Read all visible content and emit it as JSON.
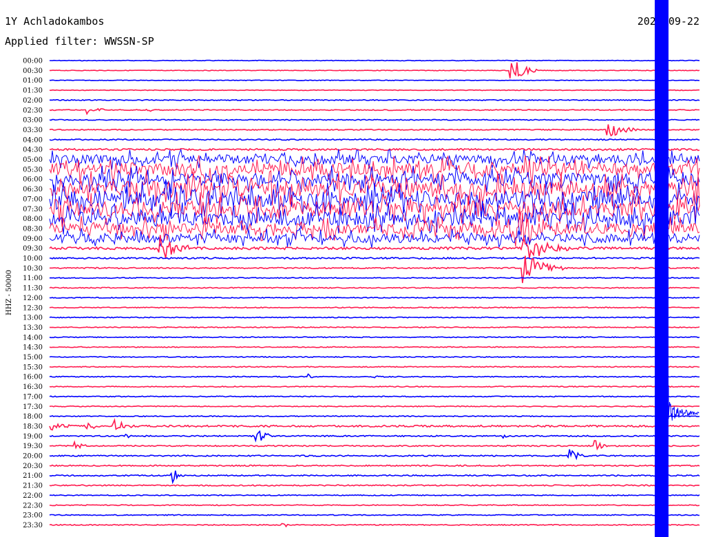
{
  "header": {
    "station": "1Y Achladokambos",
    "date": "2024-09-22",
    "filter": "Applied filter: WWSSN-SP"
  },
  "chart_data": {
    "type": "line",
    "title": "1Y Achladokambos",
    "ylabel": "HHZ - 50000",
    "trace_colors": [
      "#0000ff",
      "#ff1a4f"
    ],
    "rows": [
      {
        "label": "00:00",
        "color": "#0000ff",
        "activity": 0.2,
        "events": []
      },
      {
        "label": "00:30",
        "color": "#ff1a4f",
        "activity": 0.2,
        "events": [
          {
            "x": 0.71,
            "amp": 20,
            "len": 0.04
          }
        ]
      },
      {
        "label": "01:00",
        "color": "#0000ff",
        "activity": 0.2,
        "events": []
      },
      {
        "label": "01:30",
        "color": "#ff1a4f",
        "activity": 0.2,
        "events": []
      },
      {
        "label": "02:00",
        "color": "#0000ff",
        "activity": 0.3,
        "events": []
      },
      {
        "label": "02:30",
        "color": "#ff1a4f",
        "activity": 0.3,
        "events": [
          {
            "x": 0.06,
            "amp": 6,
            "len": 0.03
          },
          {
            "x": 0.15,
            "amp": 6,
            "len": 0.01
          }
        ]
      },
      {
        "label": "03:00",
        "color": "#0000ff",
        "activity": 0.3,
        "events": []
      },
      {
        "label": "03:30",
        "color": "#ff1a4f",
        "activity": 0.3,
        "events": [
          {
            "x": 0.86,
            "amp": 14,
            "len": 0.05
          }
        ]
      },
      {
        "label": "04:00",
        "color": "#0000ff",
        "activity": 0.4,
        "events": []
      },
      {
        "label": "04:30",
        "color": "#ff1a4f",
        "activity": 0.6,
        "events": []
      },
      {
        "label": "05:00",
        "color": "#0000ff",
        "activity": 2.5,
        "events": []
      },
      {
        "label": "05:30",
        "color": "#ff1a4f",
        "activity": 3.5,
        "events": []
      },
      {
        "label": "06:00",
        "color": "#0000ff",
        "activity": 3.5,
        "events": []
      },
      {
        "label": "06:30",
        "color": "#ff1a4f",
        "activity": 4.5,
        "events": []
      },
      {
        "label": "07:00",
        "color": "#0000ff",
        "activity": 4.5,
        "events": []
      },
      {
        "label": "07:30",
        "color": "#ff1a4f",
        "activity": 4.5,
        "events": []
      },
      {
        "label": "08:00",
        "color": "#0000ff",
        "activity": 4.0,
        "events": []
      },
      {
        "label": "08:30",
        "color": "#ff1a4f",
        "activity": 3.0,
        "events": [
          {
            "x": 0.72,
            "amp": 30,
            "len": 0.08
          }
        ]
      },
      {
        "label": "09:00",
        "color": "#0000ff",
        "activity": 2.5,
        "events": []
      },
      {
        "label": "09:30",
        "color": "#ff1a4f",
        "activity": 0.8,
        "events": [
          {
            "x": 0.17,
            "amp": 20,
            "len": 0.05
          },
          {
            "x": 0.73,
            "amp": 25,
            "len": 0.07
          }
        ]
      },
      {
        "label": "10:00",
        "color": "#0000ff",
        "activity": 0.5,
        "events": []
      },
      {
        "label": "10:30",
        "color": "#ff1a4f",
        "activity": 0.4,
        "events": [
          {
            "x": 0.73,
            "amp": 25,
            "len": 0.06
          }
        ]
      },
      {
        "label": "11:00",
        "color": "#0000ff",
        "activity": 0.3,
        "events": []
      },
      {
        "label": "11:30",
        "color": "#ff1a4f",
        "activity": 0.3,
        "events": []
      },
      {
        "label": "12:00",
        "color": "#0000ff",
        "activity": 0.3,
        "events": []
      },
      {
        "label": "12:30",
        "color": "#ff1a4f",
        "activity": 0.3,
        "events": []
      },
      {
        "label": "13:00",
        "color": "#0000ff",
        "activity": 0.3,
        "events": []
      },
      {
        "label": "13:30",
        "color": "#ff1a4f",
        "activity": 0.3,
        "events": []
      },
      {
        "label": "14:00",
        "color": "#0000ff",
        "activity": 0.3,
        "events": []
      },
      {
        "label": "14:30",
        "color": "#ff1a4f",
        "activity": 0.3,
        "events": []
      },
      {
        "label": "15:00",
        "color": "#0000ff",
        "activity": 0.3,
        "events": []
      },
      {
        "label": "15:30",
        "color": "#ff1a4f",
        "activity": 0.3,
        "events": []
      },
      {
        "label": "16:00",
        "color": "#0000ff",
        "activity": 0.3,
        "events": [
          {
            "x": 0.4,
            "amp": 5,
            "len": 0.01
          },
          {
            "x": 0.5,
            "amp": 4,
            "len": 0.01
          }
        ]
      },
      {
        "label": "16:30",
        "color": "#ff1a4f",
        "activity": 0.3,
        "events": []
      },
      {
        "label": "17:00",
        "color": "#0000ff",
        "activity": 0.3,
        "events": []
      },
      {
        "label": "17:30",
        "color": "#ff1a4f",
        "activity": 0.3,
        "events": []
      },
      {
        "label": "18:00",
        "color": "#0000ff",
        "activity": 0.3,
        "events": []
      },
      {
        "label": "18:30",
        "color": "#ff1a4f",
        "activity": 0.6,
        "events": [
          {
            "x": 0.0,
            "amp": 8,
            "len": 0.03
          },
          {
            "x": 0.06,
            "amp": 6,
            "len": 0.02
          },
          {
            "x": 0.1,
            "amp": 8,
            "len": 0.04
          }
        ]
      },
      {
        "label": "19:00",
        "color": "#0000ff",
        "activity": 0.4,
        "events": [
          {
            "x": 0.12,
            "amp": 4,
            "len": 0.02
          },
          {
            "x": 0.32,
            "amp": 10,
            "len": 0.03
          },
          {
            "x": 0.7,
            "amp": 3,
            "len": 0.01
          }
        ]
      },
      {
        "label": "19:30",
        "color": "#ff1a4f",
        "activity": 0.4,
        "events": [
          {
            "x": 0.04,
            "amp": 6,
            "len": 0.02
          },
          {
            "x": 0.84,
            "amp": 10,
            "len": 0.02
          }
        ]
      },
      {
        "label": "20:00",
        "color": "#0000ff",
        "activity": 0.4,
        "events": [
          {
            "x": 0.8,
            "amp": 10,
            "len": 0.03
          }
        ]
      },
      {
        "label": "20:30",
        "color": "#ff1a4f",
        "activity": 0.4,
        "events": []
      },
      {
        "label": "21:00",
        "color": "#0000ff",
        "activity": 0.4,
        "events": [
          {
            "x": 0.19,
            "amp": 10,
            "len": 0.02
          }
        ]
      },
      {
        "label": "21:30",
        "color": "#ff1a4f",
        "activity": 0.4,
        "events": []
      },
      {
        "label": "22:00",
        "color": "#0000ff",
        "activity": 0.3,
        "events": []
      },
      {
        "label": "22:30",
        "color": "#ff1a4f",
        "activity": 0.3,
        "events": []
      },
      {
        "label": "23:00",
        "color": "#0000ff",
        "activity": 0.3,
        "events": []
      },
      {
        "label": "23:30",
        "color": "#ff1a4f",
        "activity": 0.3,
        "events": [
          {
            "x": 0.36,
            "amp": 6,
            "len": 0.01
          }
        ]
      }
    ]
  }
}
